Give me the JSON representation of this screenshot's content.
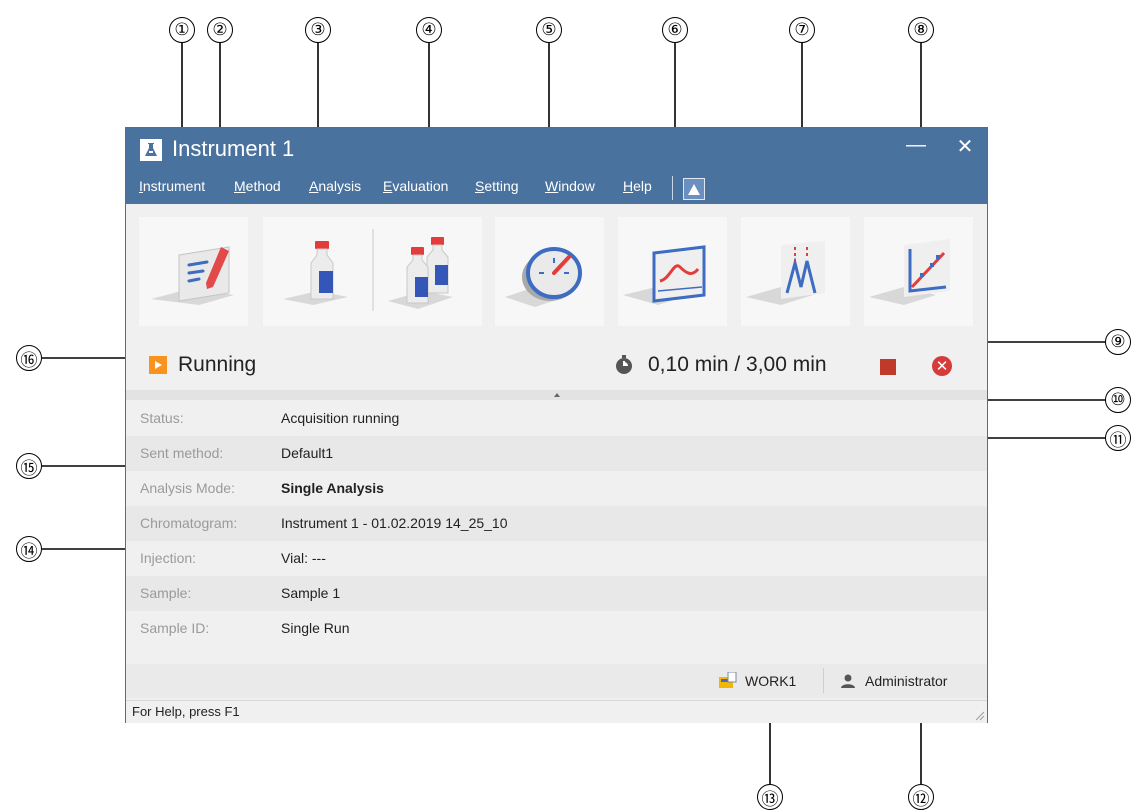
{
  "window": {
    "title": "Instrument 1",
    "minimize_glyph": "—",
    "close_glyph": "✕",
    "accent_color": "#49729f"
  },
  "menu": {
    "items": [
      "Instrument",
      "Method",
      "Analysis",
      "Evaluation",
      "Setting",
      "Window",
      "Help"
    ]
  },
  "toolbar": {
    "buttons": [
      {
        "icon": "edit-method-icon"
      },
      {
        "icon": "single-vial-icon"
      },
      {
        "icon": "multiple-vials-icon"
      },
      {
        "icon": "gauge-icon"
      },
      {
        "icon": "chromatogram-monitor-icon"
      },
      {
        "icon": "peaks-icon"
      },
      {
        "icon": "calibration-icon"
      }
    ]
  },
  "run_status": {
    "state": "Running",
    "timer": "0,10 min / 3,00 min",
    "state_color": "#f7931e",
    "stop_color": "#c0392b",
    "abort_color": "#d63b3b"
  },
  "info": {
    "rows": [
      {
        "label": "Status:",
        "value": "Acquisition running"
      },
      {
        "label": "Sent method:",
        "value": "Default1"
      },
      {
        "label": "Analysis Mode:",
        "value": "Single Analysis"
      },
      {
        "label": "Chromatogram:",
        "value": "Instrument 1 - 01.02.2019 14_25_10"
      },
      {
        "label": "Injection:",
        "value": "Vial: ---"
      },
      {
        "label": "Sample:",
        "value": "Sample 1"
      },
      {
        "label": "Sample ID:",
        "value": "Single Run"
      }
    ]
  },
  "footer": {
    "workspace": "WORK1",
    "user": "Administrator"
  },
  "statusbar": {
    "help": "For Help, press F1"
  },
  "callouts": [
    "①",
    "②",
    "③",
    "④",
    "⑤",
    "⑥",
    "⑦",
    "⑧",
    "⑨",
    "⑩",
    "⑪",
    "⑫",
    "⑬",
    "⑭",
    "⑮",
    "⑯"
  ]
}
